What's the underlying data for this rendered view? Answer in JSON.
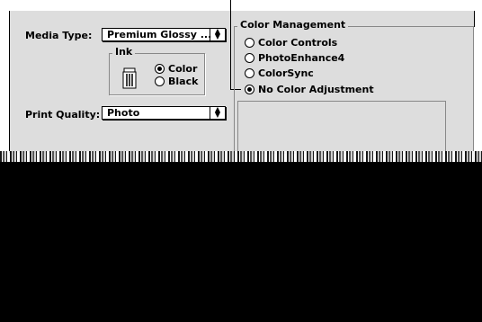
{
  "print_settings": {
    "media_type_label": "Media Type:",
    "media_type_value": "Premium Glossy ...",
    "ink_group_title": "Ink",
    "ink_color_label": "Color",
    "ink_black_label": "Black",
    "ink_selected": "Color",
    "print_quality_label": "Print Quality:",
    "print_quality_value": "Photo"
  },
  "color_management": {
    "title": "Color Management",
    "options": [
      {
        "label": "Color Controls",
        "selected": false
      },
      {
        "label": "PhotoEnhance4",
        "selected": false
      },
      {
        "label": "ColorSync",
        "selected": false
      },
      {
        "label": "No Color Adjustment",
        "selected": true
      }
    ]
  },
  "icons": {
    "popup_arrows": "up-down-arrows-icon",
    "ink_cartridge": "ink-cartridge-icon"
  }
}
